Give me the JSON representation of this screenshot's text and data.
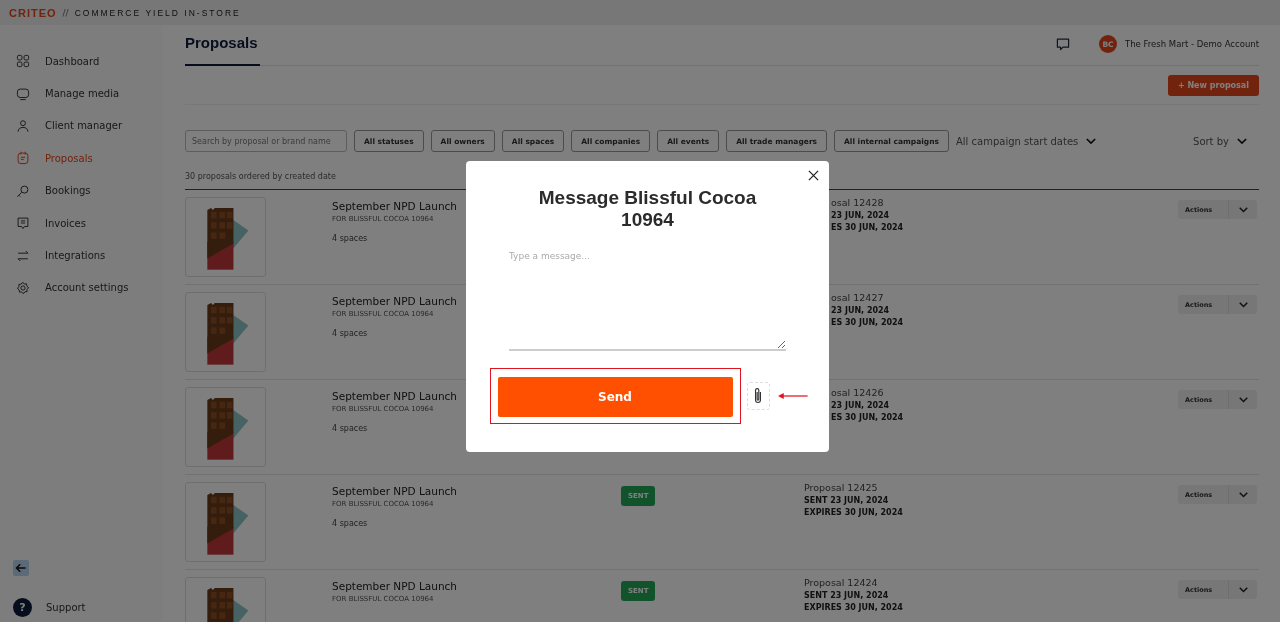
{
  "header": {
    "brand": "CRITEO",
    "separator": "//",
    "product": "COMMERCE YIELD IN-STORE"
  },
  "sidebar": {
    "items": [
      {
        "label": "Dashboard",
        "selected": false
      },
      {
        "label": "Manage media",
        "selected": false
      },
      {
        "label": "Client manager",
        "selected": false
      },
      {
        "label": "Proposals",
        "selected": true
      },
      {
        "label": "Bookings",
        "selected": false
      },
      {
        "label": "Invoices",
        "selected": false
      },
      {
        "label": "Integrations",
        "selected": false
      },
      {
        "label": "Account settings",
        "selected": false
      }
    ],
    "support_mark": "?",
    "support": "Support"
  },
  "page": {
    "title": "Proposals",
    "account_initials": "BC",
    "account_name": "The Fresh Mart - Demo Account",
    "new_button": "+ New proposal"
  },
  "filters": {
    "search_placeholder": "Search by proposal or brand name",
    "buttons": [
      "All statuses",
      "All owners",
      "All spaces",
      "All companies",
      "All events",
      "All trade managers",
      "All internal campaigns"
    ],
    "date_filter": "All campaign start dates",
    "sort": "Sort by"
  },
  "count_text": "30 proposals ordered by created date",
  "rows": [
    {
      "title": "September NPD Launch",
      "brand": "FOR BLISSFUL COCOA 10964",
      "spaces": "4 spaces",
      "proposal": "osal 12428",
      "sent": "23 JUN, 2024",
      "expires": "ES 30 JUN, 2024",
      "under_dialog": true,
      "actions": "Actions"
    },
    {
      "title": "September NPD Launch",
      "brand": "FOR BLISSFUL COCOA 10964",
      "spaces": "4 spaces",
      "proposal": "osal 12427",
      "sent": "23 JUN, 2024",
      "expires": "ES 30 JUN, 2024",
      "under_dialog": true,
      "actions": "Actions"
    },
    {
      "title": "September NPD Launch",
      "brand": "FOR BLISSFUL COCOA 10964",
      "spaces": "4 spaces",
      "proposal": "osal 12426",
      "sent": "23 JUN, 2024",
      "expires": "ES 30 JUN, 2024",
      "under_dialog": true,
      "actions": "Actions"
    },
    {
      "title": "September NPD Launch",
      "brand": "FOR BLISSFUL COCOA 10964",
      "spaces": "4 spaces",
      "status": "SENT",
      "proposal": "Proposal 12425",
      "sent": "SENT 23 JUN, 2024",
      "expires": "EXPIRES 30 JUN, 2024",
      "under_dialog": false,
      "actions": "Actions"
    },
    {
      "title": "September NPD Launch",
      "brand": "FOR BLISSFUL COCOA 10964",
      "status": "SENT",
      "proposal": "Proposal 12424",
      "sent": "SENT 23 JUN, 2024",
      "expires": "EXPIRES 30 JUN, 2024",
      "under_dialog": false,
      "actions": "Actions"
    }
  ],
  "dialog": {
    "title": "Message Blissful Cocoa 10964",
    "placeholder": "Type a message...",
    "send": "Send"
  }
}
